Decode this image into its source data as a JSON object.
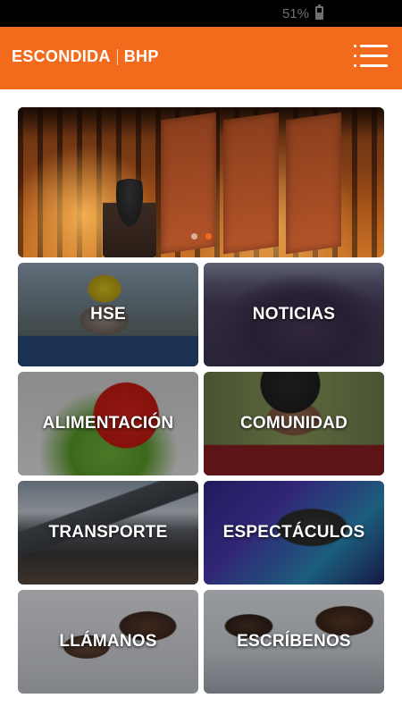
{
  "status_bar": {
    "battery_text": "51%"
  },
  "app_bar": {
    "brand_left": "ESCONDIDA",
    "brand_right": "BHP",
    "accent_color": "#f26b1d",
    "menu_icon": "hamburger-menu-icon"
  },
  "hero": {
    "slide_count": 2,
    "active_slide": 2
  },
  "tiles": [
    {
      "label": "HSE"
    },
    {
      "label": "NOTICIAS"
    },
    {
      "label": "ALIMENTACIÓN"
    },
    {
      "label": "COMUNIDAD"
    },
    {
      "label": "TRANSPORTE"
    },
    {
      "label": "ESPECTÁCULOS"
    },
    {
      "label": "LLÁMANOS"
    },
    {
      "label": "ESCRÍBENOS"
    }
  ]
}
